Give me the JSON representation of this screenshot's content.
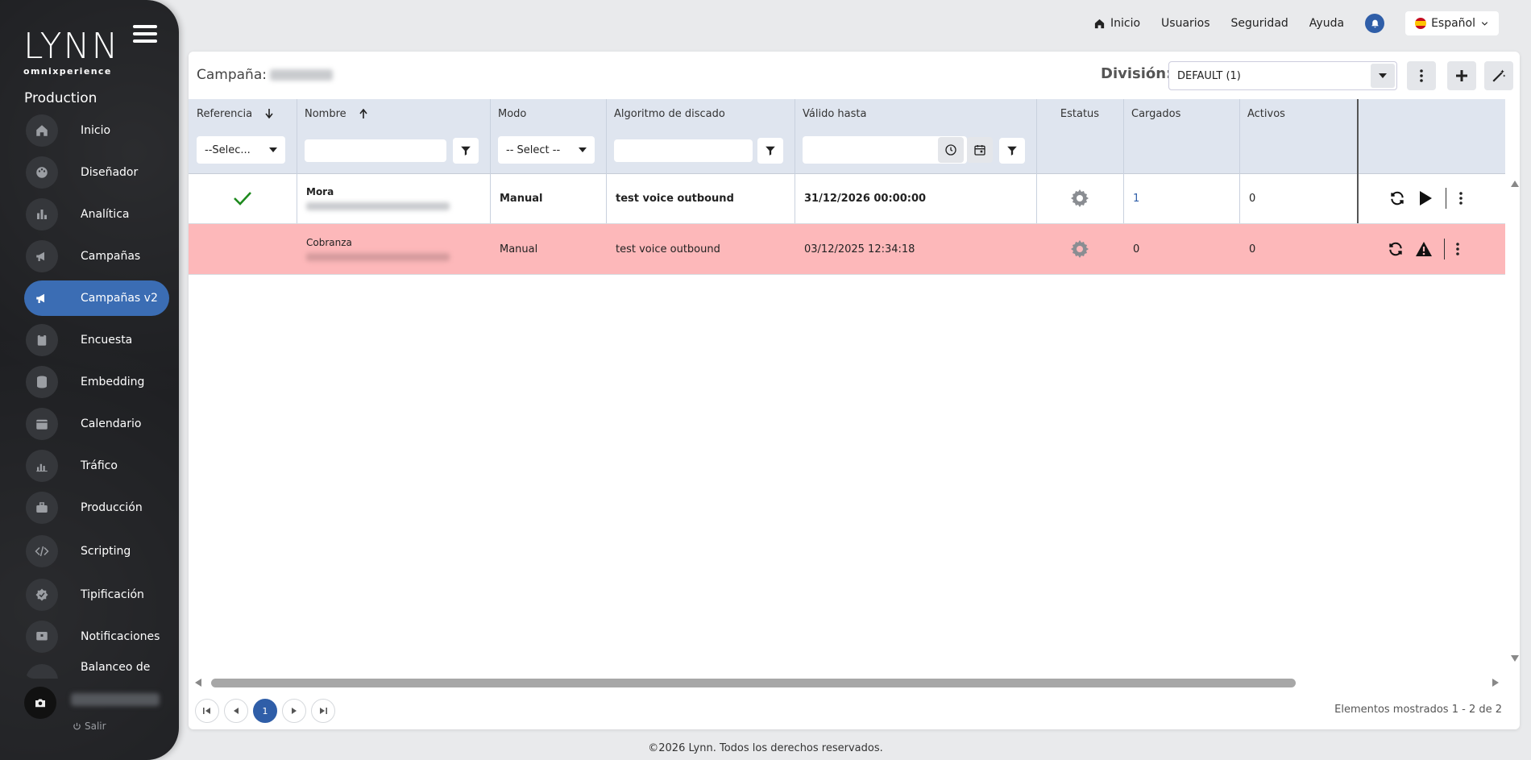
{
  "sidebar": {
    "logo_word": "LYNN",
    "logo_sub": "omnixperience",
    "environment": "Production",
    "items": [
      {
        "label": "Inicio",
        "icon": "home-icon"
      },
      {
        "label": "Diseñador",
        "icon": "palette-icon"
      },
      {
        "label": "Analítica",
        "icon": "bar-chart-icon"
      },
      {
        "label": "Campañas",
        "icon": "megaphone-icon"
      },
      {
        "label": "Campañas v2",
        "icon": "megaphone-icon",
        "active": true
      },
      {
        "label": "Encuesta",
        "icon": "clipboard-icon"
      },
      {
        "label": "Embedding",
        "icon": "database-icon"
      },
      {
        "label": "Calendario",
        "icon": "calendar-icon"
      },
      {
        "label": "Tráfico",
        "icon": "traffic-chart-icon"
      },
      {
        "label": "Producción",
        "icon": "briefcase-icon"
      },
      {
        "label": "Scripting",
        "icon": "code-icon"
      },
      {
        "label": "Tipificación",
        "icon": "badge-check-icon"
      },
      {
        "label": "Notificaciones",
        "icon": "notification-icon"
      },
      {
        "label": "Balanceo de",
        "icon": "balance-icon"
      }
    ],
    "logout_label": "Salir"
  },
  "topbar": {
    "home": "Inicio",
    "users": "Usuarios",
    "security": "Seguridad",
    "help": "Ayuda",
    "language": "Español"
  },
  "panel": {
    "campaign_label": "Campaña:",
    "division_label": "División:",
    "division_value": "DEFAULT (1)"
  },
  "table": {
    "columns": [
      "Referencia",
      "Nombre",
      "Modo",
      "Algoritmo de discado",
      "Válido hasta",
      "Estatus",
      "Cargados",
      "Activos"
    ],
    "filters": {
      "referencia_select": "--Selec...",
      "modo_select": "-- Select --"
    },
    "rows": [
      {
        "nombre": "Mora",
        "modo": "Manual",
        "algoritmo": "test voice outbound",
        "valido": "31/12/2026 00:00:00",
        "cargados": "1",
        "activos": "0"
      },
      {
        "nombre": "Cobranza",
        "modo": "Manual",
        "algoritmo": "test voice outbound",
        "valido": "03/12/2025 12:34:18",
        "cargados": "0",
        "activos": "0"
      }
    ]
  },
  "pager": {
    "current_page": "1",
    "summary": "Elementos mostrados 1 - 2 de 2"
  },
  "footer": "©2026 Lynn. Todos los derechos reservados.",
  "colors": {
    "accent": "#3b6db4",
    "header_bg": "#dfe5ef",
    "error_row": "#fdb8ba",
    "ok_check": "#1e8a1e"
  }
}
